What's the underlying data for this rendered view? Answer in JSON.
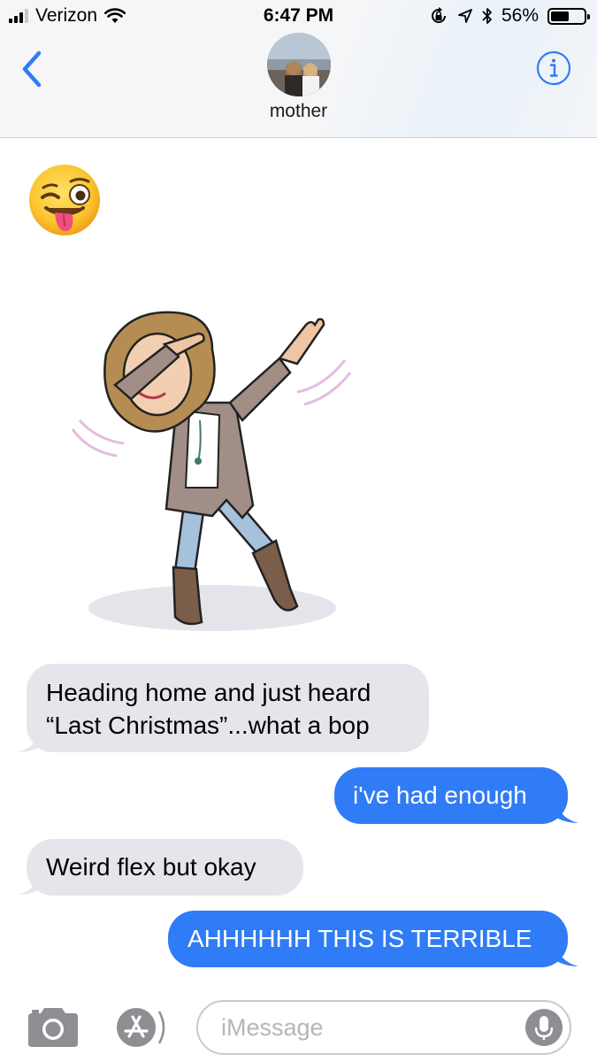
{
  "status_bar": {
    "carrier": "Verizon",
    "time": "6:47 PM",
    "battery_percent": "56%",
    "battery_level": 0.56,
    "icons": [
      "signal-icon",
      "wifi-icon",
      "orientation-lock-icon",
      "location-icon",
      "bluetooth-icon",
      "battery-icon"
    ]
  },
  "header": {
    "contact_name": "mother",
    "back_icon": "chevron-left-icon",
    "info_icon": "info-icon",
    "accent_color": "#2f7cf6"
  },
  "messages": [
    {
      "type": "emoji",
      "direction": "received",
      "content": "winking-face-with-tongue-emoji"
    },
    {
      "type": "sticker",
      "direction": "received",
      "content": "bitmoji-dab-sticker"
    },
    {
      "type": "text",
      "direction": "received",
      "lines": [
        "Heading home and just heard",
        "“Last Christmas”...what a bop"
      ]
    },
    {
      "type": "text",
      "direction": "sent",
      "text": "i've had enough"
    },
    {
      "type": "text",
      "direction": "received",
      "text": "Weird flex but okay"
    },
    {
      "type": "text",
      "direction": "sent",
      "text": "AHHHHHH THIS IS TERRIBLE"
    }
  ],
  "colors": {
    "sent_bubble": "#2f7cf6",
    "received_bubble": "#e6e5eb"
  },
  "input_bar": {
    "placeholder": "iMessage",
    "camera_icon": "camera-icon",
    "apps_icon": "app-store-icon",
    "mic_icon": "microphone-icon"
  }
}
